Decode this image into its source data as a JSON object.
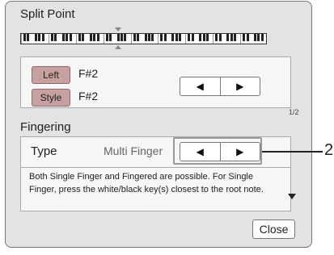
{
  "split_point": {
    "title": "Split Point",
    "left_label": "Left",
    "left_value": "F#2",
    "style_label": "Style",
    "style_value": "F#2",
    "page_indicator": "1/2"
  },
  "fingering": {
    "title": "Fingering",
    "type_label": "Type",
    "type_value": "Multi Finger",
    "description": "Both Single Finger and Fingered are possible. For Single Finger, press the white/black key(s) closest to the root note."
  },
  "close_label": "Close",
  "callout_number": "2",
  "colors": {
    "pill": "#c9a0a0",
    "background": "#e3e3e3",
    "panel": "#f6f6f6"
  }
}
